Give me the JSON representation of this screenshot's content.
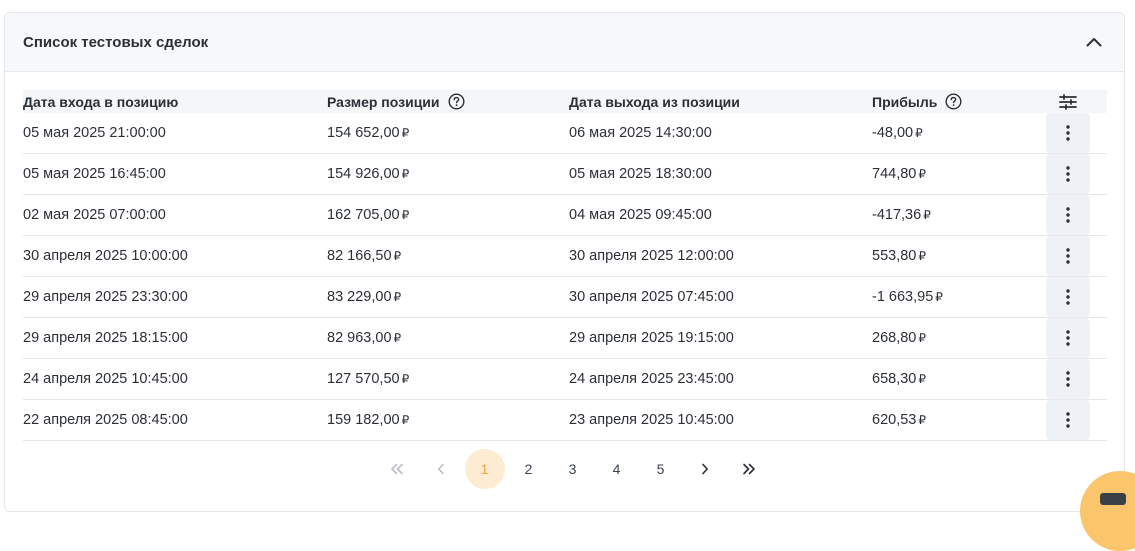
{
  "card": {
    "title": "Список тестовых сделок",
    "collapse_icon": "chevron-up-icon"
  },
  "table": {
    "headers": {
      "entry_date": "Дата входа в позицию",
      "size": "Размер позиции",
      "exit_date": "Дата выхода из позиции",
      "profit": "Прибыль",
      "help_icon": "question-circle-icon",
      "settings_icon": "sliders-icon"
    },
    "currency": "₽",
    "rows": [
      {
        "entry": "05 мая 2025 21:00:00",
        "size": "154 652,00",
        "exit": "06 мая 2025 14:30:00",
        "profit": "-48,00"
      },
      {
        "entry": "05 мая 2025 16:45:00",
        "size": "154 926,00",
        "exit": "05 мая 2025 18:30:00",
        "profit": "744,80"
      },
      {
        "entry": "02 мая 2025 07:00:00",
        "size": "162 705,00",
        "exit": "04 мая 2025 09:45:00",
        "profit": "-417,36"
      },
      {
        "entry": "30 апреля 2025 10:00:00",
        "size": "82 166,50",
        "exit": "30 апреля 2025 12:00:00",
        "profit": "553,80"
      },
      {
        "entry": "29 апреля 2025 23:30:00",
        "size": "83 229,00",
        "exit": "30 апреля 2025 07:45:00",
        "profit": "-1 663,95"
      },
      {
        "entry": "29 апреля 2025 18:15:00",
        "size": "82 963,00",
        "exit": "29 апреля 2025 19:15:00",
        "profit": "268,80"
      },
      {
        "entry": "24 апреля 2025 10:45:00",
        "size": "127 570,50",
        "exit": "24 апреля 2025 23:45:00",
        "profit": "658,30"
      },
      {
        "entry": "22 апреля 2025 08:45:00",
        "size": "159 182,00",
        "exit": "23 апреля 2025 10:45:00",
        "profit": "620,53"
      }
    ],
    "row_menu_icon": "more-vertical-icon"
  },
  "pagination": {
    "first_icon": "chevrons-left-icon",
    "prev_icon": "chevron-left-icon",
    "pages": [
      "1",
      "2",
      "3",
      "4",
      "5"
    ],
    "active_page": "1",
    "next_icon": "chevron-right-icon",
    "last_icon": "chevrons-right-icon"
  },
  "colors": {
    "accent": "#f0a24b",
    "active_page_bg": "#fdecd2",
    "header_bg": "#f7f8fa",
    "row_border": "#e6e8eb",
    "menu_btn_bg": "#eef2f6"
  }
}
